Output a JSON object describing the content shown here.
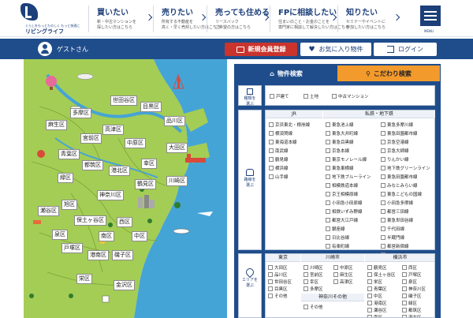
{
  "header": {
    "logo": {
      "sub": "くらしをもっとたのしく もっと快適に",
      "name": "リビングライフ"
    },
    "nav": [
      {
        "title": "買いたい",
        "desc1": "新・中古マンションを",
        "desc2": "探したい方はこちら"
      },
      {
        "title": "売りたい",
        "desc1": "所有する不動産を",
        "desc2": "高く・早く売却したい方はこちら"
      },
      {
        "title": "売っても住める",
        "desc1": "リースバック",
        "desc2": "ご希望の方はこちら"
      },
      {
        "title": "FPに相談したい",
        "desc1": "住まいのこと・お金のことを",
        "desc2": "専門家に相談して解決したい方はこちら"
      },
      {
        "title": "知りたい",
        "desc1": "セミナーやイベントに",
        "desc2": "参加したい方はこちら"
      }
    ],
    "menu_label": "MENU"
  },
  "userbar": {
    "guest": "ゲストさん",
    "register": "新規会員登録",
    "favorites": "お気に入り物件",
    "login": "ログイン"
  },
  "map": {
    "wards": [
      "世田谷区",
      "目黒区",
      "多摩区",
      "品川区",
      "麻生区",
      "高津区",
      "宮前区",
      "中原区",
      "大田区",
      "青葉区",
      "都筑区",
      "港北区",
      "幸区",
      "緑区",
      "鶴見区",
      "神奈川区",
      "川崎区",
      "瀬谷区",
      "旭区",
      "保土ヶ谷区",
      "西区",
      "泉区",
      "南区",
      "中区",
      "戸塚区",
      "港南区",
      "磯子区",
      "栄区",
      "金沢区"
    ]
  },
  "search": {
    "tab_property": "物件検索",
    "tab_detail": "こだわり検索",
    "type_label": [
      "種類を",
      "選ぶ"
    ],
    "types": [
      "戸建て",
      "土地",
      "中古マンション"
    ],
    "route_label": [
      "路線を",
      "選ぶ"
    ],
    "jr_header": "JR",
    "private_header": "私鉄・地下鉄",
    "jr_lines": [
      "京浜東北・根岸線",
      "横須賀線",
      "東海道本線",
      "南武線",
      "鶴見線",
      "横浜線",
      "山手線"
    ],
    "private_left": [
      "東急池上線",
      "東急大井町線",
      "東急目黒線",
      "京急本線",
      "東京モノレール線",
      "東急東横線",
      "地下鉄ブルーライン",
      "相模鉄道本線",
      "京王相模原線",
      "小田急小田原線",
      "相鉄いずみ野線",
      "都営大江戸線",
      "銀座線",
      "日比谷線",
      "有楽町線"
    ],
    "private_right": [
      "東急多摩川線",
      "東急田園都市線",
      "京急空港線",
      "京急大師線",
      "りんかい線",
      "地下鉄グリーンライン",
      "東急田園都市線",
      "みなとみらい線",
      "東急こどもの国線",
      "小田急多摩線",
      "都営三田線",
      "東急世田谷線",
      "千代田線",
      "半蔵門線",
      "都営新宿線",
      "丸ノ内線",
      "東西線",
      "南北線"
    ],
    "area_label": [
      "エリアを",
      "選ぶ"
    ],
    "tokyo_header": "東京",
    "kawasaki_header": "川崎市",
    "yokohama_header": "横浜市",
    "kawasaki_other_header": "神奈川その他",
    "tokyo": [
      "大田区",
      "品川区",
      "世田谷区",
      "目黒区",
      "その他"
    ],
    "kawasaki": [
      "川崎区",
      "中原区",
      "宮前区",
      "麻生区",
      "幸区",
      "高津区",
      "多摩区"
    ],
    "yokohama": [
      "鶴見区",
      "西区",
      "保土ヶ谷区",
      "戸塚区",
      "栄区",
      "泉区",
      "青葉区",
      "神奈川区",
      "中区",
      "磯子区",
      "港南区",
      "緑区",
      "瀬谷区",
      "都筑区",
      "南区",
      "港北区",
      "旭区",
      "金沢区"
    ],
    "kanagawa_other": [
      "その他"
    ]
  }
}
